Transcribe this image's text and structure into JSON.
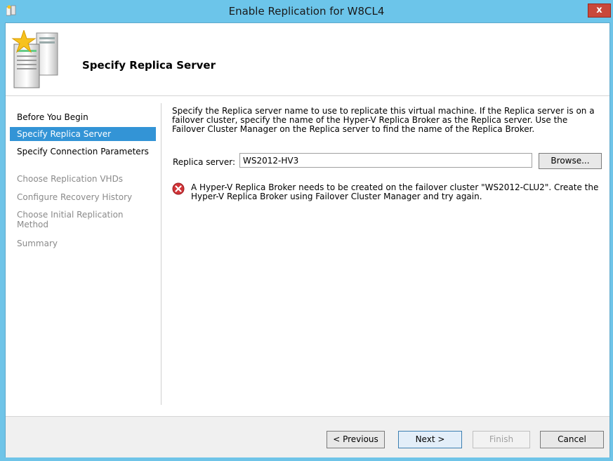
{
  "window": {
    "title": "Enable Replication for W8CL4",
    "close_glyph": "x",
    "app_icon": "hyper-v-icon"
  },
  "header": {
    "title": "Specify Replica Server",
    "icon": "replica-server-icon"
  },
  "nav": {
    "items": [
      {
        "label": "Before You Begin",
        "state": "normal"
      },
      {
        "label": "Specify Replica Server",
        "state": "selected"
      },
      {
        "label": "Specify Connection Parameters",
        "state": "normal"
      },
      {
        "label": "Choose Replication VHDs",
        "state": "disabled"
      },
      {
        "label": "Configure Recovery History",
        "state": "disabled"
      },
      {
        "label": "Choose Initial Replication Method",
        "state": "disabled"
      },
      {
        "label": "Summary",
        "state": "disabled"
      }
    ]
  },
  "content": {
    "description": "Specify the Replica server name to use to replicate this virtual machine. If the Replica server is on a failover cluster, specify the name of the Hyper-V Replica Broker as the Replica server. Use the Failover Cluster Manager on the Replica server to find the name of the Replica Broker.",
    "server_label": "Replica server:",
    "server_value": "WS2012-HV3",
    "browse_label": "Browse...",
    "error_icon": "error-icon",
    "error_message": "A Hyper-V Replica Broker needs to be created on the failover cluster \"WS2012-CLU2\". Create the Hyper-V Replica Broker using Failover Cluster Manager and try again."
  },
  "footer": {
    "previous_label": "< Previous",
    "next_label": "Next >",
    "finish_label": "Finish",
    "cancel_label": "Cancel"
  },
  "colors": {
    "titlebar": "#6cc5ea",
    "selection": "#3394d6",
    "close": "#c9483a",
    "error": "#d13438"
  }
}
